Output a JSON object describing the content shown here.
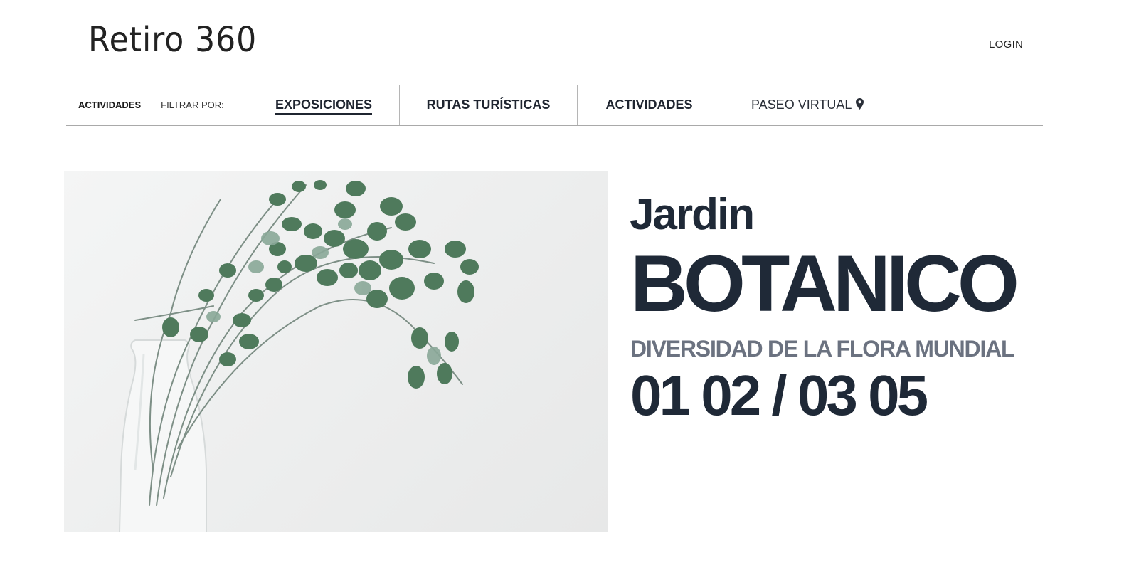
{
  "header": {
    "logo": "Retiro 360",
    "login_label": "LOGIN"
  },
  "nav": {
    "category_label": "ACTIVIDADES",
    "filter_label": "FILTRAR POR:",
    "tabs": [
      {
        "label": "EXPOSICIONES",
        "active": true
      },
      {
        "label": "RUTAS TURÍSTICAS",
        "active": false
      },
      {
        "label": "ACTIVIDADES",
        "active": false
      }
    ],
    "virtual_tour_label": "PASEO VIRTUAL",
    "virtual_tour_icon": "map-pin-icon"
  },
  "hero": {
    "image_icon": "eucalyptus-vase-photo",
    "title_small": "Jardin",
    "title_big": "BOTANICO",
    "subtitle": "DIVERSIDAD DE LA FLORA MUNDIAL",
    "dates": "01 02 / 03 05"
  },
  "colors": {
    "text_dark": "#1f2937",
    "text_gray": "#6b7280",
    "divider": "#b5b5b5",
    "leaf": "#4f7a5c"
  }
}
